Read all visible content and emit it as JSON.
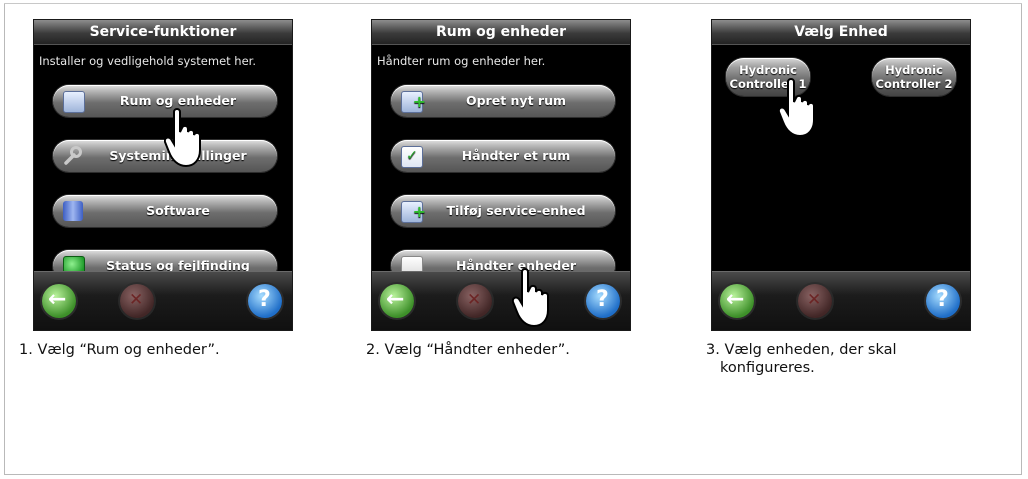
{
  "steps": [
    {
      "screen": {
        "title": "Service-funktioner",
        "subtitle": "Installer og vedligehold systemet her.",
        "buttons": [
          {
            "label": "Rum og enheder",
            "icon": "document-icon"
          },
          {
            "label": "Systemindstillinger",
            "icon": "wrench-icon"
          },
          {
            "label": "Software",
            "icon": "database-icon"
          },
          {
            "label": "Status og fejlfinding",
            "icon": "check-icon"
          }
        ]
      },
      "caption": "1. Vælg “Rum og enheder”."
    },
    {
      "screen": {
        "title": "Rum og enheder",
        "subtitle": "Håndter rum og enheder her.",
        "buttons": [
          {
            "label": "Opret nyt rum",
            "icon": "add-document-icon"
          },
          {
            "label": "Håndter et rum",
            "icon": "checklist-icon"
          },
          {
            "label": "Tilføj service-enhed",
            "icon": "add-device-icon"
          },
          {
            "label": "Håndter enheder",
            "icon": "blank-document-icon"
          }
        ]
      },
      "caption": "2. Vælg “Håndter enheder”."
    },
    {
      "screen": {
        "title": "Vælg Enhed",
        "controllers": [
          {
            "line1": "Hydronic",
            "line2": "Controller 1"
          },
          {
            "line1": "Hydronic",
            "line2": "Controller 2"
          }
        ]
      },
      "caption_line1": "3. Vælg enheden, der skal",
      "caption_line2": "konfigureres."
    }
  ],
  "nav": {
    "back_icon": "back-arrow-icon",
    "cancel_icon": "cancel-x-icon",
    "help_icon": "help-icon"
  }
}
